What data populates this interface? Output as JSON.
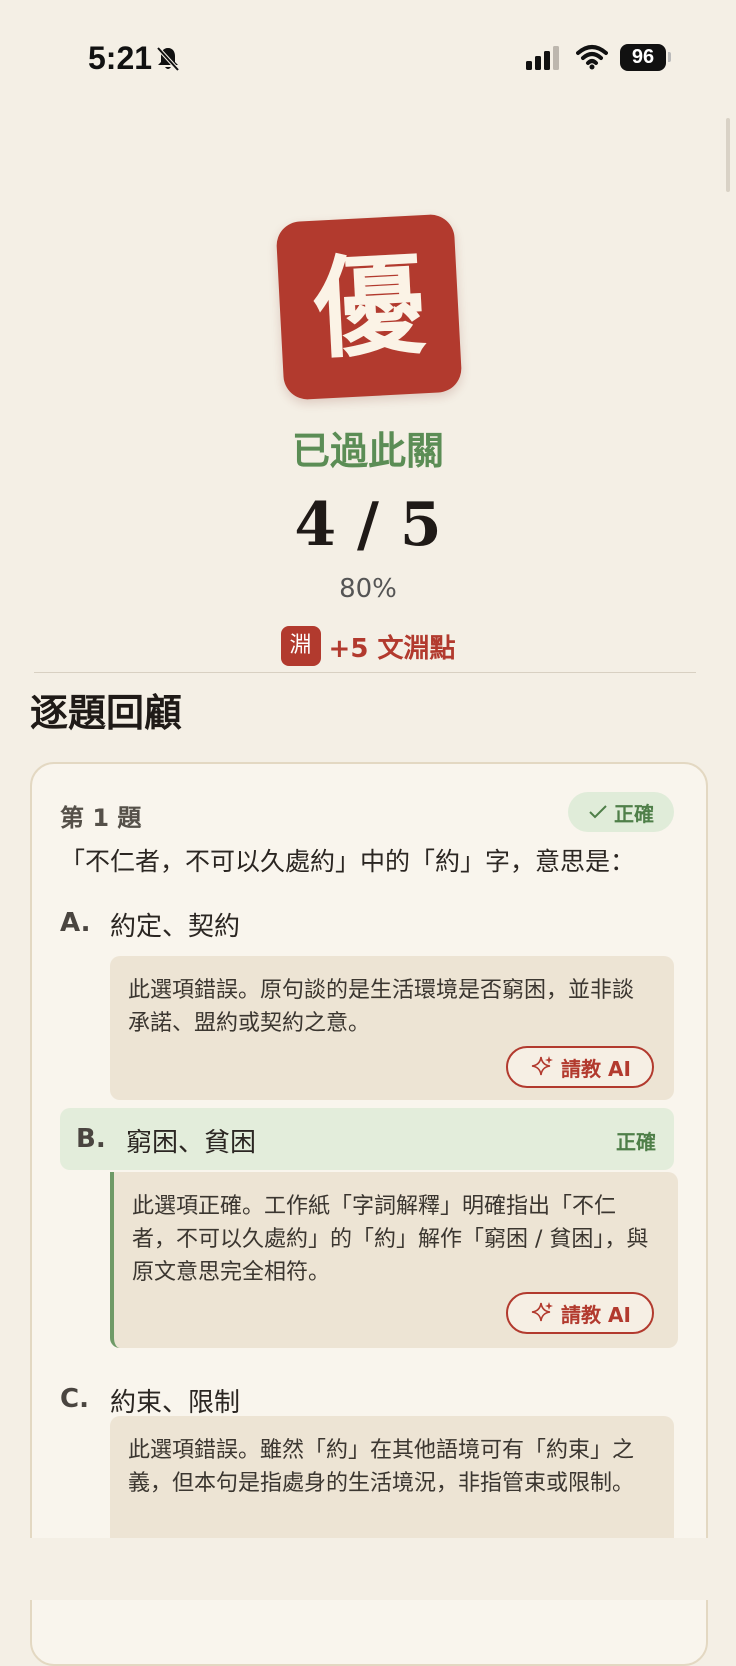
{
  "status_bar": {
    "time": "5:21",
    "battery": "96"
  },
  "result": {
    "grade": "優",
    "title": "已過此關",
    "score": "4 / 5",
    "percent": "80%",
    "points_icon": "淵",
    "points_text": "+5 文淵點"
  },
  "review": {
    "section_title": "逐題回顧",
    "question_number": "第 1 題",
    "status": "正確",
    "question": "「不仁者，不可以久處約」中的「約」字，意思是：",
    "ask_label": "請教 AI",
    "correct_label": "正確",
    "options": [
      {
        "letter": "A.",
        "text": "約定、契約",
        "explanation": "此選項錯誤。原句談的是生活環境是否窮困，並非談承諾、盟約或契約之意。"
      },
      {
        "letter": "B.",
        "text": "窮困、貧困",
        "explanation": "此選項正確。工作紙「字詞解釋」明確指出「不仁者，不可以久處約」的「約」解作「窮困 / 貧困」，與原文意思完全相符。"
      },
      {
        "letter": "C.",
        "text": "約束、限制",
        "explanation": "此選項錯誤。雖然「約」在其他語境可有「約束」之義，但本句是指處身的生活境況，非指管束或限制。"
      }
    ]
  },
  "colors": {
    "accent_red": "#b23a2e",
    "accent_green": "#5b8d55",
    "background": "#f4efe5"
  }
}
